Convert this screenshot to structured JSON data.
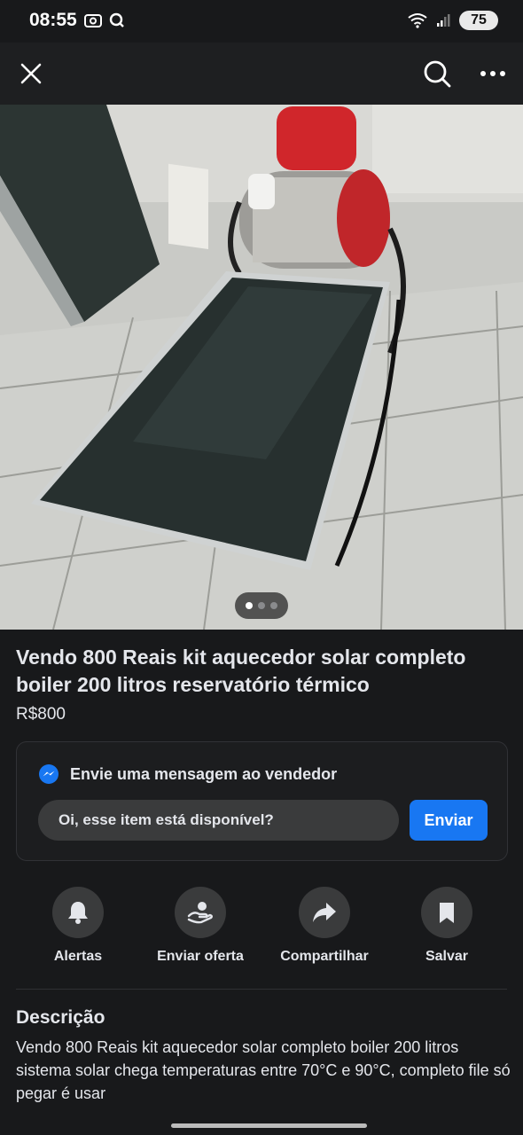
{
  "status_bar": {
    "time": "08:55",
    "battery": "75"
  },
  "icons": {
    "close": "close-icon",
    "search": "search-icon",
    "more": "more-icon",
    "messenger": "messenger-icon",
    "bell": "bell-icon",
    "offer": "offer-icon",
    "share": "share-icon",
    "bookmark": "bookmark-icon"
  },
  "carousel": {
    "count": 3,
    "active_index": 0
  },
  "listing": {
    "title": "Vendo 800 Reais kit aquecedor solar completo boiler 200 litros reservatório térmico",
    "price": "R$800"
  },
  "message": {
    "header": "Envie uma mensagem ao vendedor",
    "input_text": "Oi, esse item está disponível?",
    "send_label": "Enviar"
  },
  "actions": [
    {
      "label": "Alertas"
    },
    {
      "label": "Enviar oferta"
    },
    {
      "label": "Compartilhar"
    },
    {
      "label": "Salvar"
    }
  ],
  "description": {
    "heading": "Descrição",
    "text": "Vendo 800 Reais kit aquecedor solar completo boiler 200 litros sistema solar chega temperaturas entre 70°C e 90°C, completo file só pegar é usar"
  },
  "colors": {
    "accent": "#1877f2",
    "background": "#18191b",
    "card": "#3a3b3c"
  }
}
